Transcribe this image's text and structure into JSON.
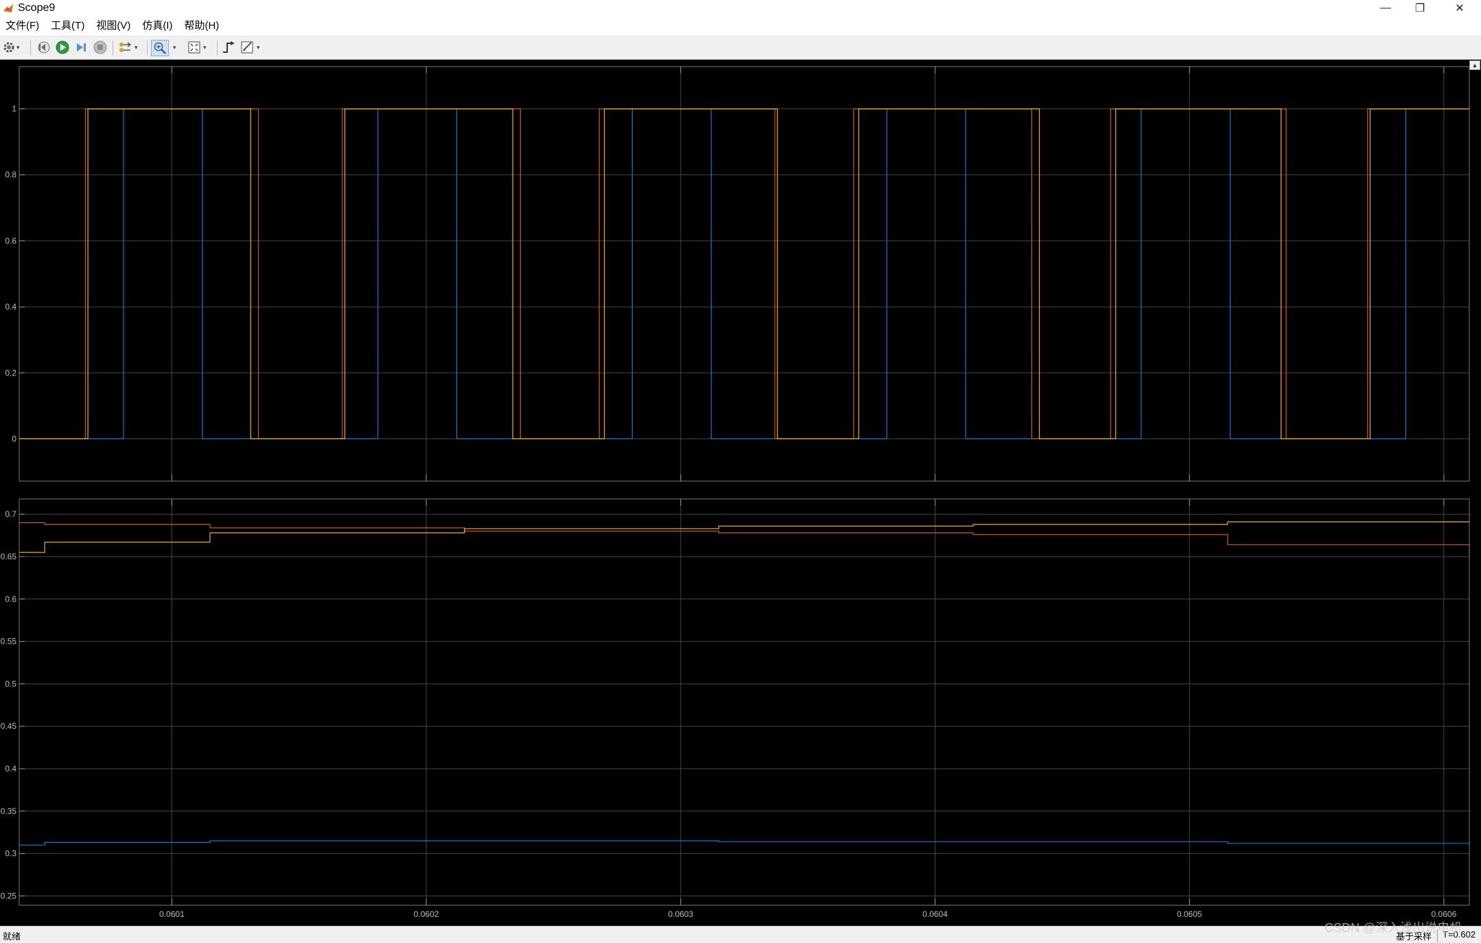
{
  "window": {
    "title": "Scope9",
    "minimize": "—",
    "restore": "❐",
    "close": "✕"
  },
  "menu": {
    "items": [
      "文件(F)",
      "工具(T)",
      "视图(V)",
      "仿真(I)",
      "帮助(H)"
    ],
    "dock_arrow": "⬎"
  },
  "toolbar": {
    "icons": [
      "gear-icon",
      "step-back-icon",
      "run-icon",
      "step-forward-icon",
      "stop-icon",
      "highlight-signals-icon",
      "zoom-in-icon",
      "fit-view-icon",
      "trigger-icon",
      "measurements-icon"
    ]
  },
  "status": {
    "text": "就绪",
    "mode": "基于采样",
    "time": "T=0.602"
  },
  "watermark": "CSDN @深入浅出说电机",
  "colors": {
    "background": "#000000",
    "grid": "#474747",
    "axis_text": "#bdbdbd",
    "series_blue": "#0b7bd2",
    "series_orange": "#d9531e",
    "series_yellow": "#edb11f"
  },
  "chart_data": [
    {
      "type": "line",
      "title": "",
      "xlim": [
        0.06004,
        0.06061
      ],
      "ylim": [
        -0.128,
        1.128
      ],
      "yticks": [
        0,
        0.2,
        0.4,
        0.6,
        0.8,
        1
      ],
      "ytick_labels": [
        "0",
        "0.2",
        "0.4",
        "0.6",
        "0.8",
        "1"
      ],
      "xticks": [
        0.0601,
        0.0602,
        0.0603,
        0.0604,
        0.0605,
        0.0606
      ],
      "grid": true,
      "step": true,
      "series": [
        {
          "color": "#0b7bd2",
          "x": [
            0.06004,
            0.060081,
            0.060081,
            0.060112,
            0.060112,
            0.060181,
            0.060181,
            0.060212,
            0.060212,
            0.060281,
            0.060281,
            0.060312,
            0.060312,
            0.060381,
            0.060381,
            0.060412,
            0.060412,
            0.060481,
            0.060481,
            0.060516,
            0.060516,
            0.060585,
            0.060585,
            0.06061
          ],
          "y": [
            0,
            0,
            1,
            1,
            0,
            0,
            1,
            1,
            0,
            0,
            1,
            1,
            0,
            0,
            1,
            1,
            0,
            0,
            1,
            1,
            0,
            0,
            1,
            1
          ]
        },
        {
          "color": "#d9531e",
          "x": [
            0.06004,
            0.060066,
            0.060066,
            0.060134,
            0.060134,
            0.060167,
            0.060167,
            0.060237,
            0.060237,
            0.060268,
            0.060268,
            0.060337,
            0.060337,
            0.060368,
            0.060368,
            0.060438,
            0.060438,
            0.060469,
            0.060469,
            0.060538,
            0.060538,
            0.06057,
            0.06057,
            0.06061
          ],
          "y": [
            0,
            0,
            1,
            1,
            0,
            0,
            1,
            1,
            0,
            0,
            1,
            1,
            0,
            0,
            1,
            1,
            0,
            0,
            1,
            1,
            0,
            0,
            1,
            1
          ]
        },
        {
          "color": "#edb11f",
          "x": [
            0.06004,
            0.060067,
            0.060067,
            0.060131,
            0.060131,
            0.060168,
            0.060168,
            0.060234,
            0.060234,
            0.06027,
            0.06027,
            0.060338,
            0.060338,
            0.06037,
            0.06037,
            0.060441,
            0.060441,
            0.060471,
            0.060471,
            0.060536,
            0.060536,
            0.060571,
            0.060571,
            0.06061
          ],
          "y": [
            0,
            0,
            1,
            1,
            0,
            0,
            1,
            1,
            0,
            0,
            1,
            1,
            0,
            0,
            1,
            1,
            0,
            0,
            1,
            1,
            0,
            0,
            1,
            1
          ]
        }
      ]
    },
    {
      "type": "line",
      "title": "",
      "xlim": [
        0.06004,
        0.06061
      ],
      "ylim": [
        0.239,
        0.718
      ],
      "yticks": [
        0.25,
        0.3,
        0.35,
        0.4,
        0.45,
        0.5,
        0.55,
        0.6,
        0.65,
        0.7
      ],
      "ytick_labels": [
        "0.25",
        "0.3",
        "0.35",
        "0.4",
        "0.45",
        "0.5",
        "0.55",
        "0.6",
        "0.65",
        "0.7"
      ],
      "xticks": [
        0.0601,
        0.0602,
        0.0603,
        0.0604,
        0.0605,
        0.0606
      ],
      "xtick_labels": [
        "0.0601",
        "0.0602",
        "0.0603",
        "0.0604",
        "0.0605",
        "0.0606"
      ],
      "grid": true,
      "step": true,
      "series": [
        {
          "color": "#d9531e",
          "x": [
            0.06004,
            0.06005,
            0.060115,
            0.060215,
            0.060315,
            0.060415,
            0.060515,
            0.06061
          ],
          "y": [
            0.69,
            0.688,
            0.684,
            0.68,
            0.678,
            0.676,
            0.664,
            0.651
          ]
        },
        {
          "color": "#edb11f",
          "x": [
            0.06004,
            0.06005,
            0.060115,
            0.060215,
            0.060315,
            0.060415,
            0.060515,
            0.06061
          ],
          "y": [
            0.655,
            0.667,
            0.678,
            0.683,
            0.686,
            0.688,
            0.691,
            0.693
          ]
        },
        {
          "color": "#0b7bd2",
          "x": [
            0.06004,
            0.06005,
            0.060115,
            0.060215,
            0.060315,
            0.060415,
            0.060515,
            0.06061
          ],
          "y": [
            0.31,
            0.313,
            0.315,
            0.315,
            0.314,
            0.314,
            0.312,
            0.309
          ]
        }
      ]
    }
  ]
}
